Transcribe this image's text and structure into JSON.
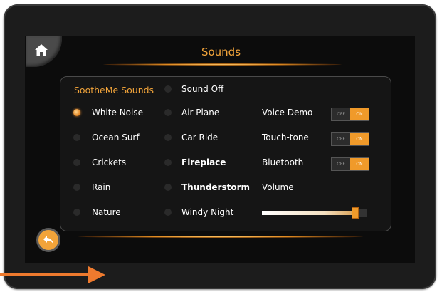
{
  "title": "Sounds",
  "heading": "SootheMe Sounds",
  "colors": {
    "accent": "#f2a43a",
    "pointer": "#ee7a2e"
  },
  "column1": [
    {
      "label": "White Noise",
      "selected": true
    },
    {
      "label": "Ocean Surf",
      "selected": false
    },
    {
      "label": "Crickets",
      "selected": false
    },
    {
      "label": "Rain",
      "selected": false
    },
    {
      "label": "Nature",
      "selected": false
    }
  ],
  "column2": [
    {
      "label": "Sound Off",
      "selected": false
    },
    {
      "label": "Air Plane",
      "selected": false
    },
    {
      "label": "Car Ride",
      "selected": false
    },
    {
      "label": "Fireplace",
      "selected": false
    },
    {
      "label": "Thunderstorm",
      "selected": false
    },
    {
      "label": "Windy Night",
      "selected": false
    }
  ],
  "settings": [
    {
      "label": "Voice Demo",
      "off": "OFF",
      "on": "ON",
      "state": "on"
    },
    {
      "label": "Touch-tone",
      "off": "OFF",
      "on": "ON",
      "state": "on"
    },
    {
      "label": "Bluetooth",
      "off": "OFF",
      "on": "ON",
      "state": "on"
    }
  ],
  "volume": {
    "label": "Volume",
    "level": 0.9
  },
  "icons": {
    "home": "home-icon",
    "back": "back-arrow-icon"
  }
}
